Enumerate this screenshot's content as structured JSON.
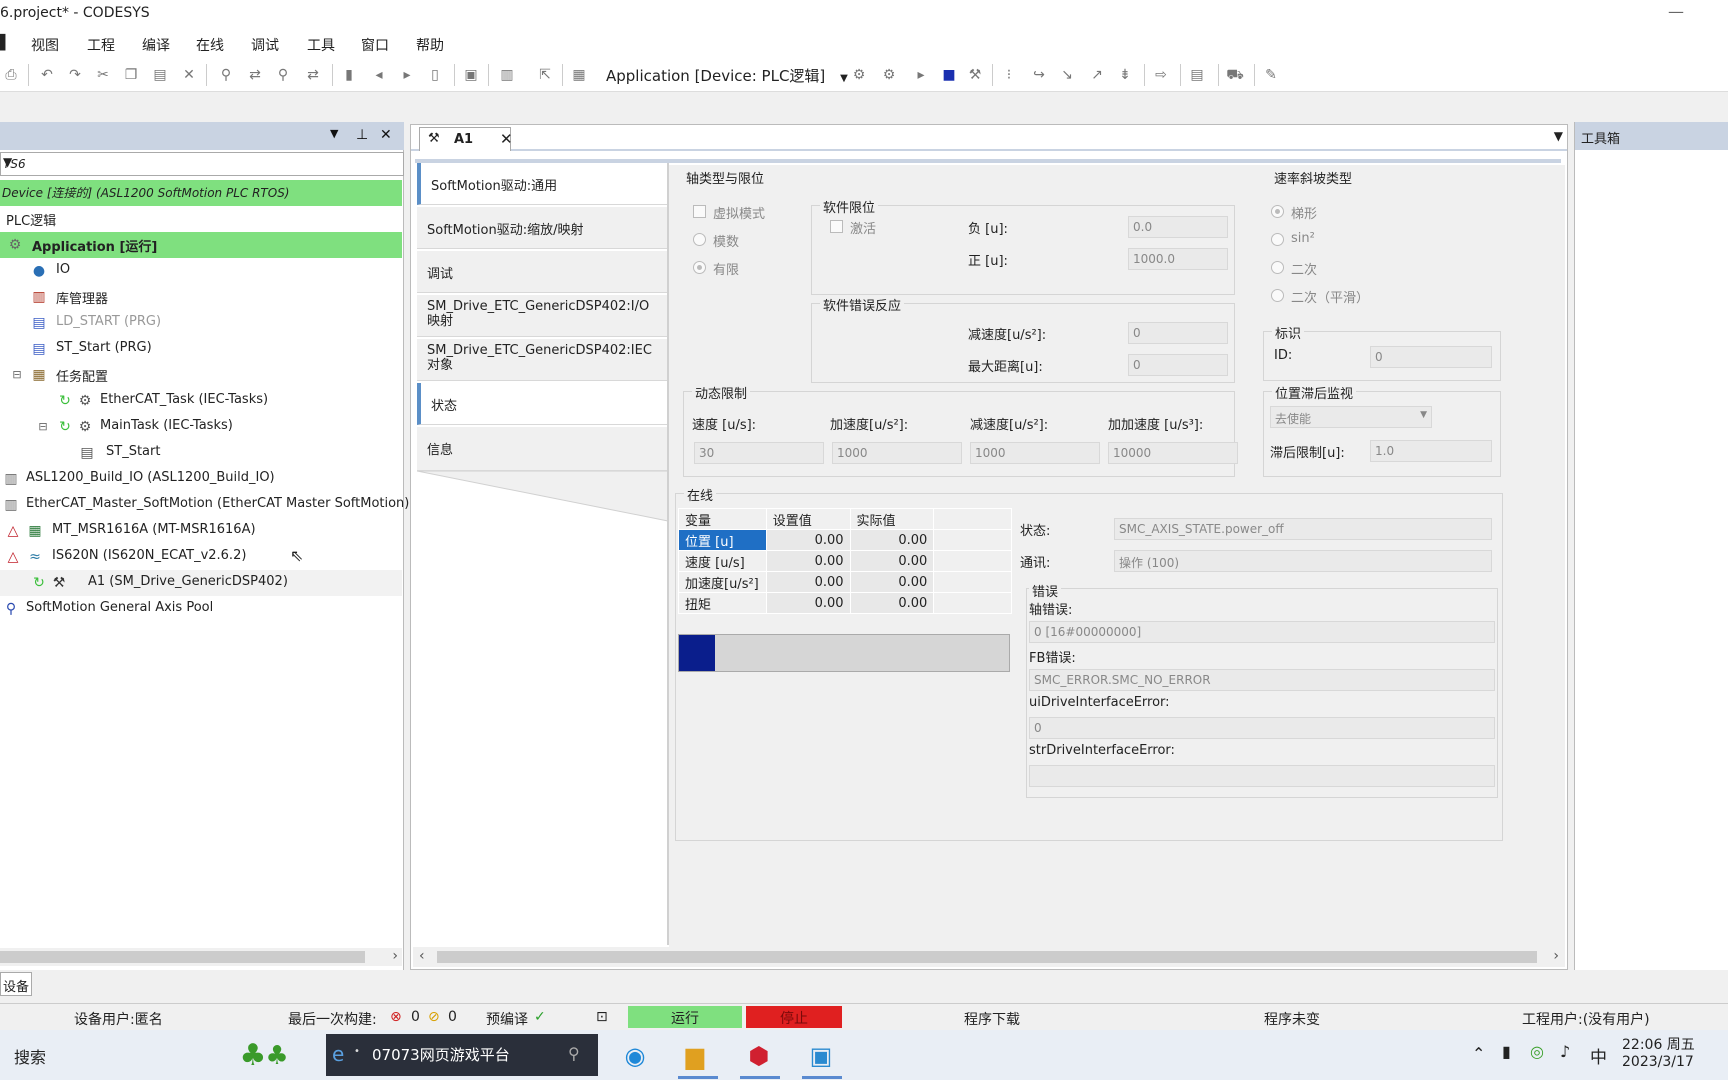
{
  "window": {
    "title": "6.project* - CODESYS"
  },
  "menu": [
    "视图",
    "工程",
    "编译",
    "在线",
    "调试",
    "工具",
    "窗口",
    "帮助"
  ],
  "toolbar": {
    "active_app": "Application [Device: PLC逻辑]"
  },
  "left_panel": {
    "combo_value": "YS6",
    "tree": [
      {
        "label": "Device [连接的] (ASL1200 SoftMotion PLC RTOS)",
        "icon": "device-icon"
      },
      {
        "label": "PLC逻辑",
        "icon": ""
      },
      {
        "label": "Application [运行]",
        "icon": "gear-icon"
      },
      {
        "label": "IO",
        "icon": "globe-icon"
      },
      {
        "label": "库管理器",
        "icon": "library-icon"
      },
      {
        "label": "LD_START (PRG)",
        "icon": "ladder-icon"
      },
      {
        "label": "ST_Start (PRG)",
        "icon": "st-icon"
      },
      {
        "label": "任务配置",
        "icon": "task-config-icon"
      },
      {
        "label": "EtherCAT_Task (IEC-Tasks)",
        "icon": "task-icon"
      },
      {
        "label": "MainTask (IEC-Tasks)",
        "icon": "task-icon"
      },
      {
        "label": "ST_Start",
        "icon": "call-icon"
      },
      {
        "label": "ASL1200_Build_IO (ASL1200_Build_IO)",
        "icon": "module-icon"
      },
      {
        "label": "EtherCAT_Master_SoftMotion (EtherCAT Master SoftMotion)",
        "icon": "module-icon"
      },
      {
        "label": "MT_MSR1616A (MT-MSR1616A)",
        "icon": "warning-icon"
      },
      {
        "label": "IS620N (IS620N_ECAT_v2.6.2)",
        "icon": "warning-icon"
      },
      {
        "label": "A1 (SM_Drive_GenericDSP402)",
        "icon": "axis-icon"
      },
      {
        "label": "SoftMotion General Axis Pool",
        "icon": "pool-icon"
      }
    ],
    "bottom_tab": "设备"
  },
  "editor": {
    "tab_label": "A1",
    "nav": [
      "SoftMotion驱动:通用",
      "SoftMotion驱动:缩放/映射",
      "调试",
      "SM_Drive_ETC_GenericDSP402:I/O映射",
      "SM_Drive_ETC_GenericDSP402:IEC对象",
      "状态",
      "信息"
    ],
    "axis_type": {
      "title": "轴类型与限位",
      "virtual_mode": "虚拟模式",
      "modulo": "模数",
      "finite": "有限"
    },
    "soft_limits": {
      "title": "软件限位",
      "activate": "激活",
      "neg_label": "负 [u]:",
      "neg_value": "0.0",
      "pos_label": "正 [u]:",
      "pos_value": "1000.0"
    },
    "soft_error": {
      "title": "软件错误反应",
      "decel_label": "减速度[u/s²]:",
      "decel_value": "0",
      "maxdist_label": "最大距离[u]:",
      "maxdist_value": "0"
    },
    "ramp_type": {
      "title": "速率斜坡类型",
      "options": [
        "梯形",
        "sin²",
        "二次",
        "二次（平滑）"
      ],
      "selected": 0
    },
    "identity": {
      "title": "标识",
      "id_label": "ID:",
      "id_value": "0"
    },
    "dynamic": {
      "title": "动态限制",
      "velocity_label": "速度 [u/s]:",
      "velocity_value": "30",
      "accel_label": "加速度[u/s²]:",
      "accel_value": "1000",
      "decel_label": "减速度[u/s²]:",
      "decel_value": "1000",
      "jerk_label": "加加速度 [u/s³]:",
      "jerk_value": "10000"
    },
    "lag": {
      "title": "位置滞后监视",
      "mode_value": "去使能",
      "limit_label": "滞后限制[u]:",
      "limit_value": "1.0"
    },
    "online": {
      "title": "在线",
      "headers": [
        "变量",
        "设置值",
        "实际值"
      ],
      "rows": [
        {
          "var": "位置 [u]",
          "set": "0.00",
          "act": "0.00"
        },
        {
          "var": "速度 [u/s]",
          "set": "0.00",
          "act": "0.00"
        },
        {
          "var": "加速度[u/s²]",
          "set": "0.00",
          "act": "0.00"
        },
        {
          "var": "扭矩",
          "set": "0.00",
          "act": "0.00"
        }
      ],
      "progress_fraction": 0.11,
      "state_label": "状态:",
      "state_value": "SMC_AXIS_STATE.power_off",
      "comm_label": "通讯:",
      "comm_value": "操作 (100)",
      "error_title": "错误",
      "axis_error_label": "轴错误:",
      "axis_error_value": "0 [16#00000000]",
      "fb_error_label": "FB错误:",
      "fb_error_value": "SMC_ERROR.SMC_NO_ERROR",
      "ui_drive_label": "uiDriveInterfaceError:",
      "ui_drive_value": "0",
      "str_drive_label": "strDriveInterfaceError:",
      "str_drive_value": ""
    }
  },
  "toolbox": {
    "title": "工具箱"
  },
  "statusbar": {
    "device_user": "设备用户:匿名",
    "last_build": "最后一次构建:",
    "errors": "0",
    "warnings": "0",
    "precompile": "预编译",
    "run": "运行",
    "stop": "停止",
    "download": "程序下载",
    "unchanged": "程序未变",
    "project_user": "工程用户:(没有用户)",
    "colors": {
      "run_bg": "#7fe07f",
      "stop_bg": "#e02020"
    }
  },
  "taskbar": {
    "search": "搜索",
    "browser_tab": "07073网页游戏平台",
    "ime": "中",
    "time": "22:06 周五",
    "date": "2023/3/17"
  }
}
